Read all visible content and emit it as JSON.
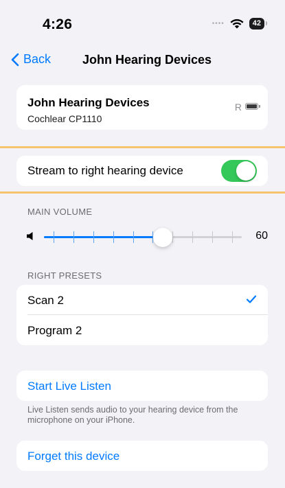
{
  "status_bar": {
    "time": "4:26",
    "signal_dots": "••••",
    "battery": "42",
    "icons": [
      "wifi-icon",
      "battery-icon"
    ]
  },
  "nav": {
    "back_label": "Back",
    "title": "John Hearing Devices",
    "back_icon": "chevron-left-icon"
  },
  "device": {
    "name": "John Hearing Devices",
    "model": "Cochlear CP1110",
    "side": "R"
  },
  "stream": {
    "label": "Stream to right hearing device",
    "enabled": true
  },
  "volume": {
    "header": "MAIN VOLUME",
    "value": "60",
    "fraction": 0.6,
    "ticks": 10
  },
  "presets": {
    "header": "RIGHT PRESETS",
    "items": [
      {
        "label": "Scan 2",
        "selected": true
      },
      {
        "label": "Program 2",
        "selected": false
      }
    ]
  },
  "live_listen": {
    "label": "Start Live Listen",
    "footer": "Live Listen sends audio to your hearing device from the microphone on your iPhone."
  },
  "forget": {
    "label": "Forget this device"
  },
  "colors": {
    "accent": "#007aff",
    "toggle_on": "#34c759",
    "highlight": "#f5c46c",
    "background": "#f2f2f7"
  }
}
